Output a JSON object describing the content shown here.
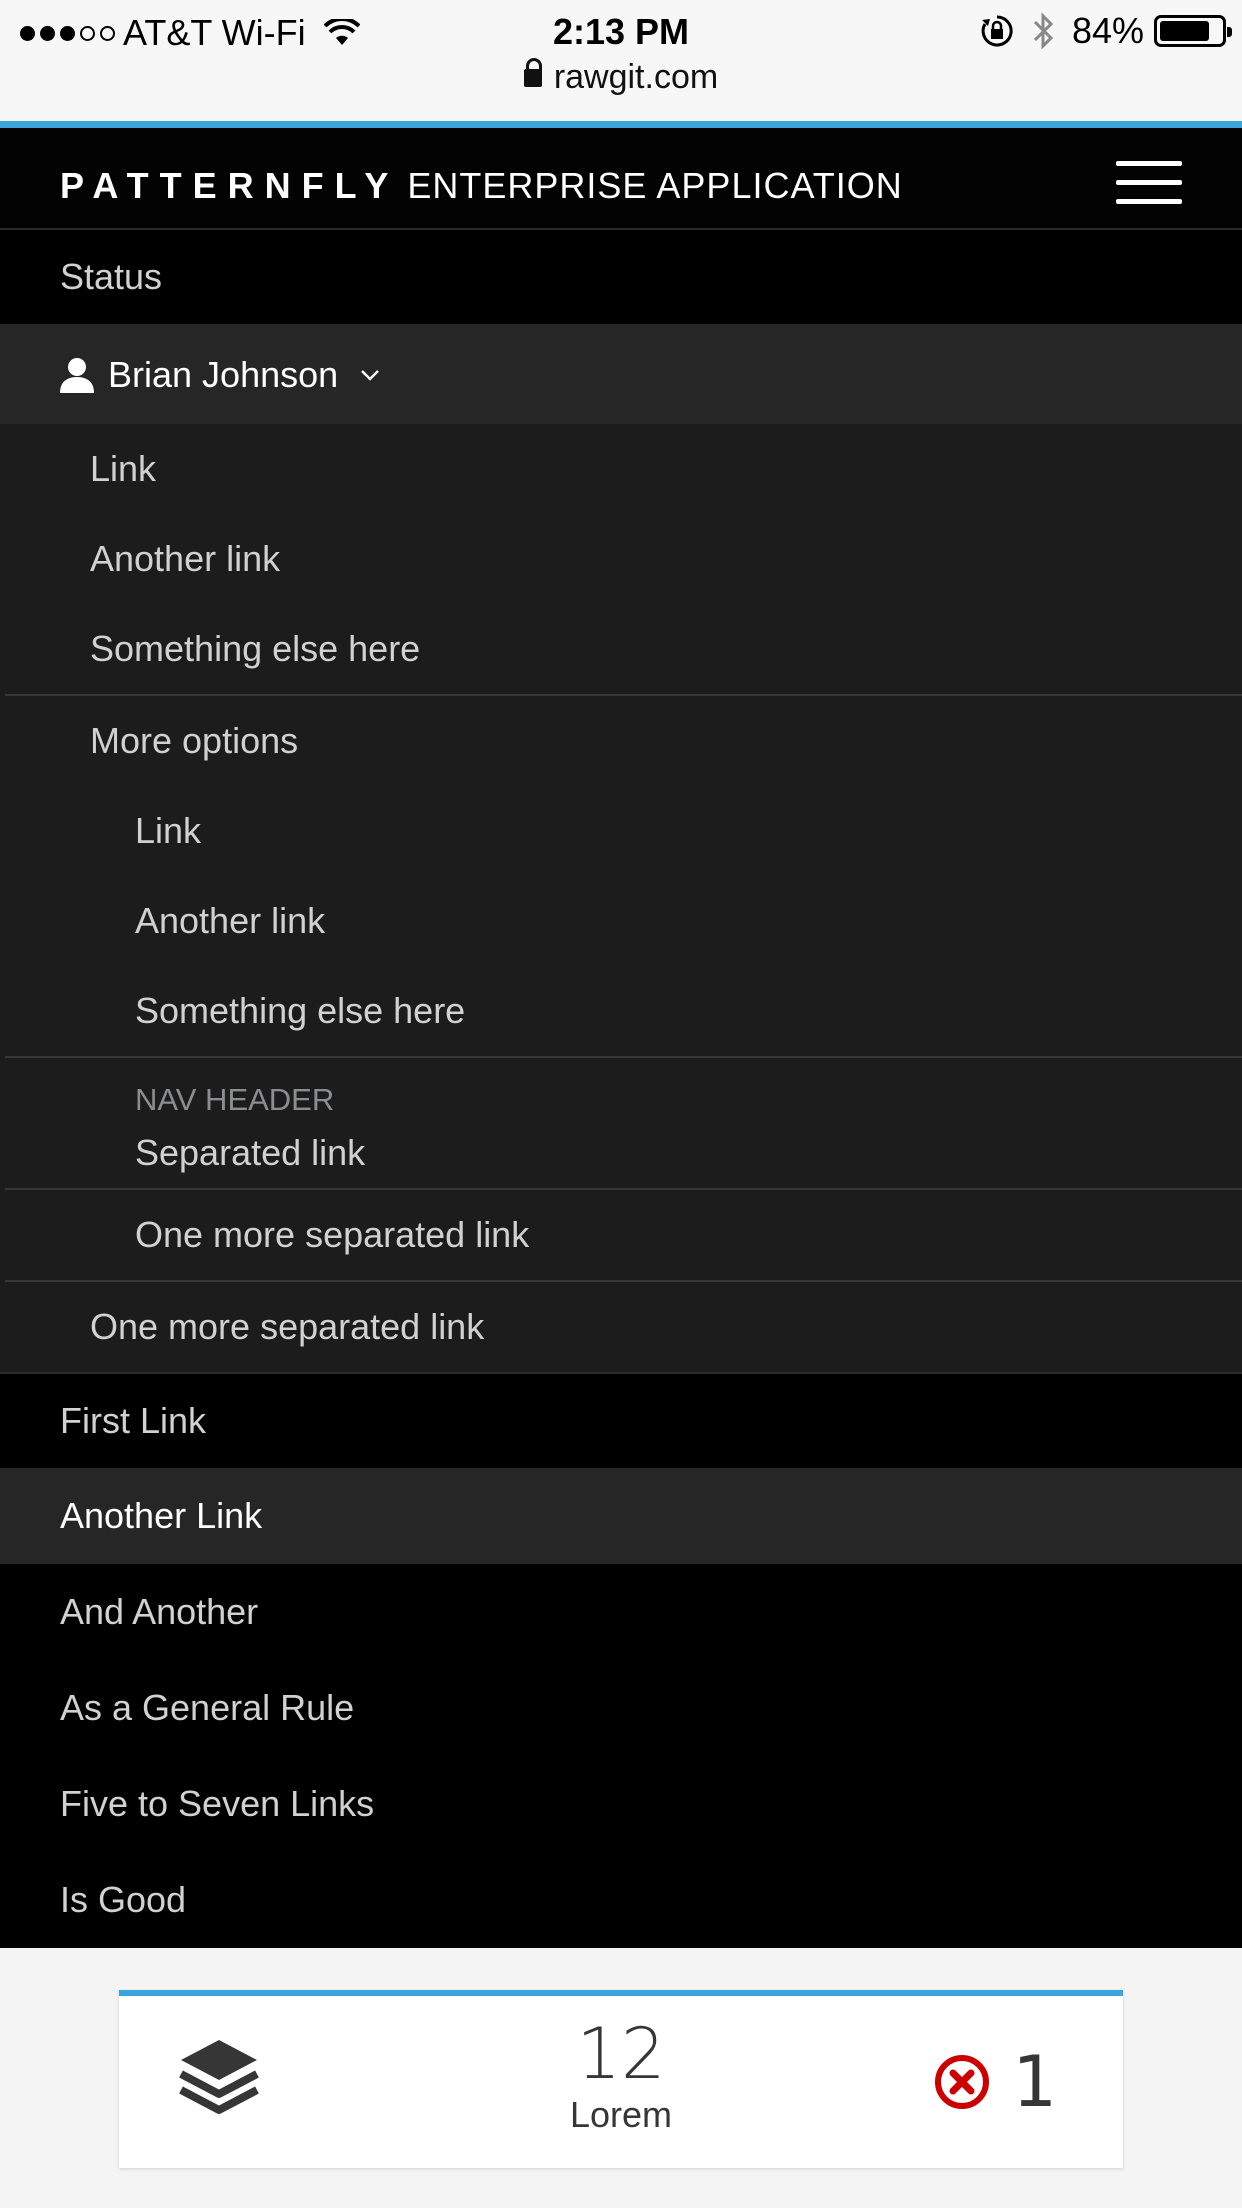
{
  "status_bar": {
    "carrier": "AT&T Wi-Fi",
    "time": "2:13 PM",
    "battery": "84%",
    "battery_level": 0.84,
    "url": "rawgit.com"
  },
  "header": {
    "brand_bold": "PATTERNFLY",
    "brand_thin": "ENTERPRISE APPLICATION"
  },
  "menu": {
    "status": "Status",
    "user": "Brian Johnson",
    "dropdown": {
      "items": [
        "Link",
        "Another link",
        "Something else here"
      ],
      "more_options": "More options",
      "sub_items": [
        "Link",
        "Another link",
        "Something else here"
      ],
      "nav_header": "NAV HEADER",
      "separated": "Separated link",
      "sub_one_more": "One more separated link",
      "one_more": "One more separated link"
    },
    "links": [
      "First Link",
      "Another Link",
      "And Another",
      "As a General Rule",
      "Five to Seven Links",
      "Is Good"
    ]
  },
  "card": {
    "count": "12",
    "label": "Lorem",
    "error_count": "1"
  },
  "colors": {
    "accent": "#39a5dc",
    "error": "#cc0000"
  },
  "icons": [
    "wifi-icon",
    "lock-rotation-icon",
    "bluetooth-icon",
    "battery-icon",
    "padlock-icon",
    "hamburger-icon",
    "user-icon",
    "chevron-down-icon",
    "stack-icon",
    "error-circle-icon"
  ]
}
